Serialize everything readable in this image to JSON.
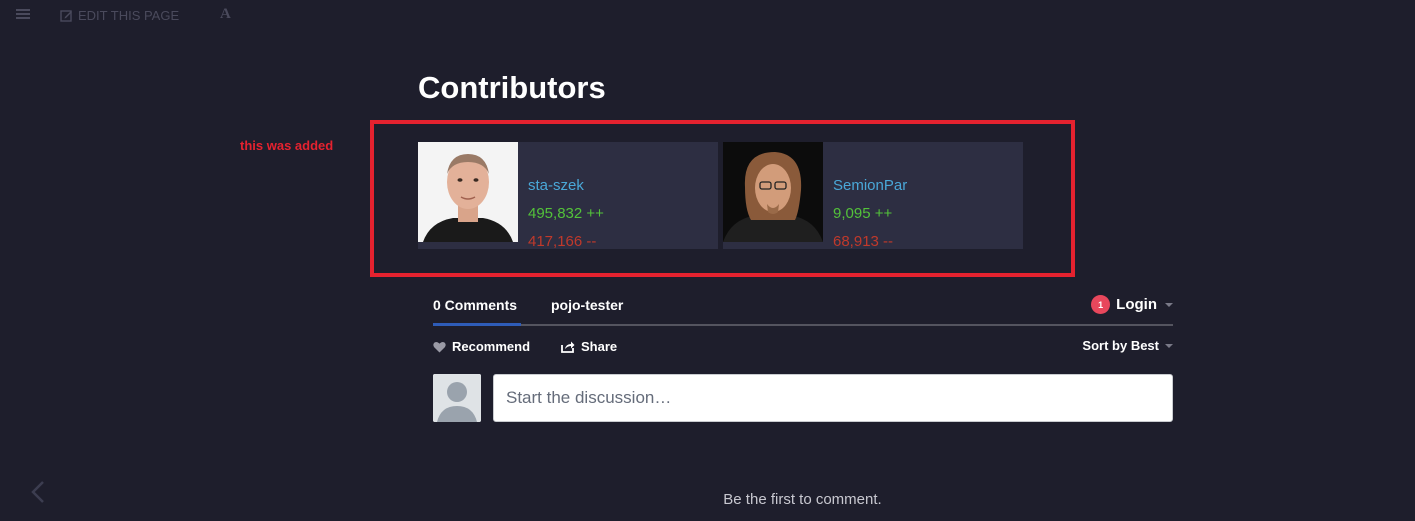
{
  "toolbar": {
    "menu_icon": "hamburger-icon",
    "edit_label": "EDIT THIS PAGE",
    "edit_icon": "pencil-square-icon",
    "font_label": "A"
  },
  "page_title": "Contributors",
  "annotation": {
    "label": "this was added",
    "color": "#e5222f"
  },
  "contributors": [
    {
      "name": "sta-szek",
      "plus": "495,832 ++",
      "minus": "417,166 --"
    },
    {
      "name": "SemionPar",
      "plus": "9,095 ++",
      "minus": "68,913 --"
    }
  ],
  "comments": {
    "tab_comments": "0 Comments",
    "tab_site": "pojo-tester",
    "login_badge": "1",
    "login_label": "Login",
    "recommend_label": "Recommend",
    "share_label": "Share",
    "sort_label": "Sort by Best",
    "input_placeholder": "Start the discussion…",
    "empty_message": "Be the first to comment."
  },
  "colors": {
    "background": "#1e1e2c",
    "card": "#2d2e42",
    "link": "#4aa8d8",
    "positive": "#53c23a",
    "negative": "#c0392b",
    "accent": "#2e5cb8"
  }
}
